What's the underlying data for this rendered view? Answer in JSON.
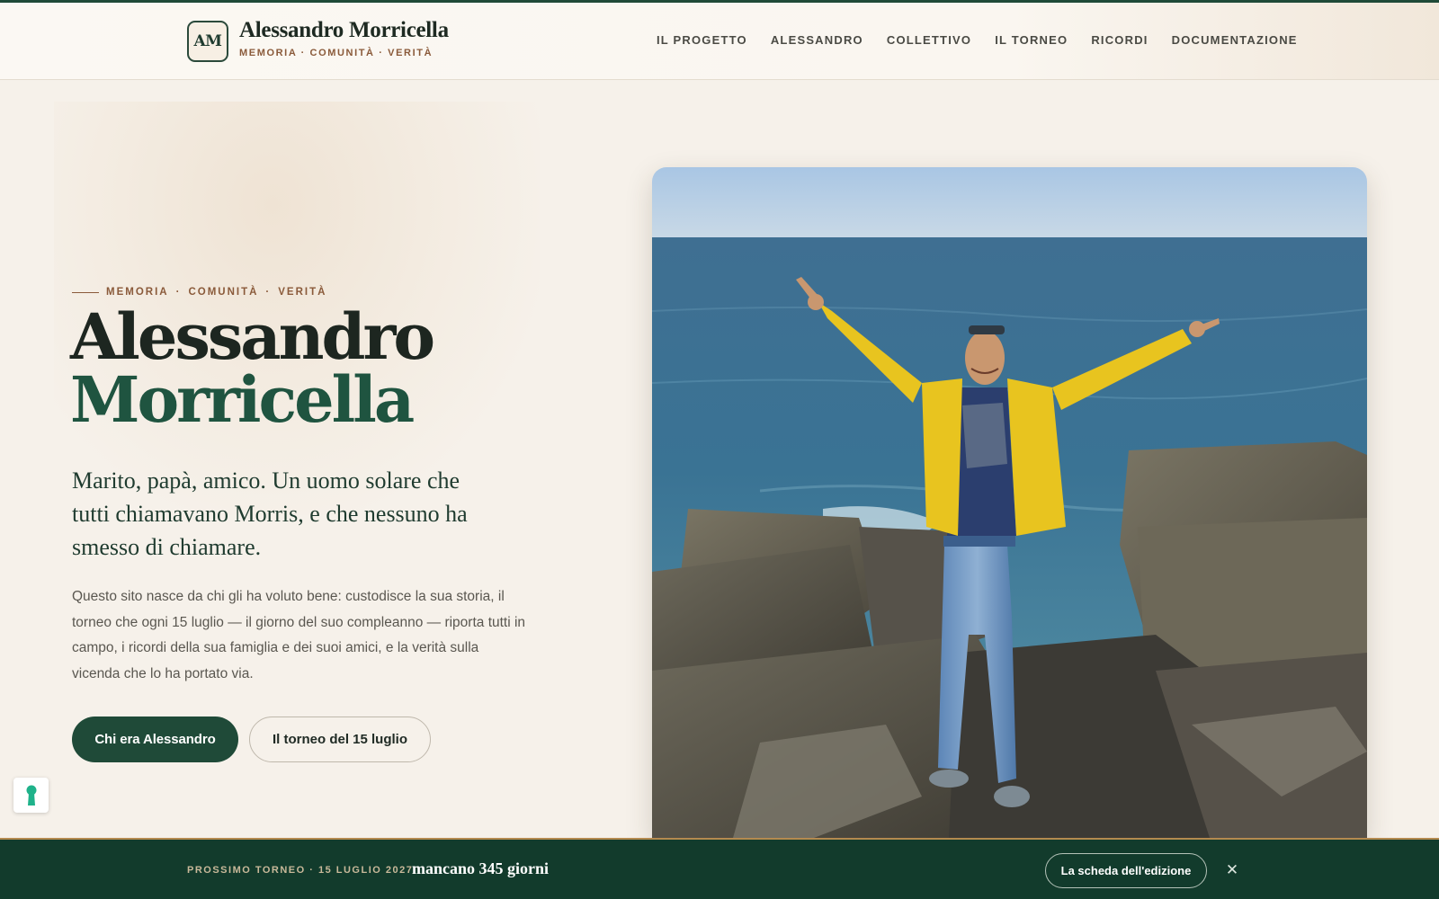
{
  "header": {
    "logo_initials": "AM",
    "brand_name": "Alessandro Morricella",
    "brand_tagline": "MEMORIA · COMUNITÀ · VERITÀ",
    "nav": [
      {
        "label": "IL PROGETTO"
      },
      {
        "label": "ALESSANDRO"
      },
      {
        "label": "COLLETTIVO"
      },
      {
        "label": "IL TORNEO"
      },
      {
        "label": "RICORDI"
      },
      {
        "label": "DOCUMENTAZIONE"
      }
    ]
  },
  "hero": {
    "eyebrow": [
      "MEMORIA",
      "COMUNITÀ",
      "VERITÀ"
    ],
    "eyebrow_separator": "·",
    "title_line1": "Alessandro",
    "title_line2": "Morricella",
    "lead": "Marito, papà, amico. Un uomo solare che tutti chiamavano Morris, e che nessuno ha smesso di chiamare.",
    "body": "Questo sito nasce da chi gli ha voluto bene: custodisce la sua storia, il torneo che ogni 15 luglio — il giorno del suo compleanno — riporta tutti in campo, i ricordi della sua famiglia e dei suoi amici, e la verità sulla vicenda che lo ha portato via.",
    "primary_button": "Chi era Alessandro",
    "secondary_button": "Il torneo del 15 luglio"
  },
  "bottom_bar": {
    "label": "PROSSIMO TORNEO · 15 LUGLIO 2027",
    "countdown": "mancano 345 giorni",
    "button": "La scheda dell'edizione",
    "close": "✕"
  },
  "colors": {
    "accent_green": "#1f4a38",
    "title_green": "#1f5440",
    "eyebrow_brown": "#8a5a3a",
    "background": "#f6f1ea",
    "bar_background": "#123b2c"
  }
}
